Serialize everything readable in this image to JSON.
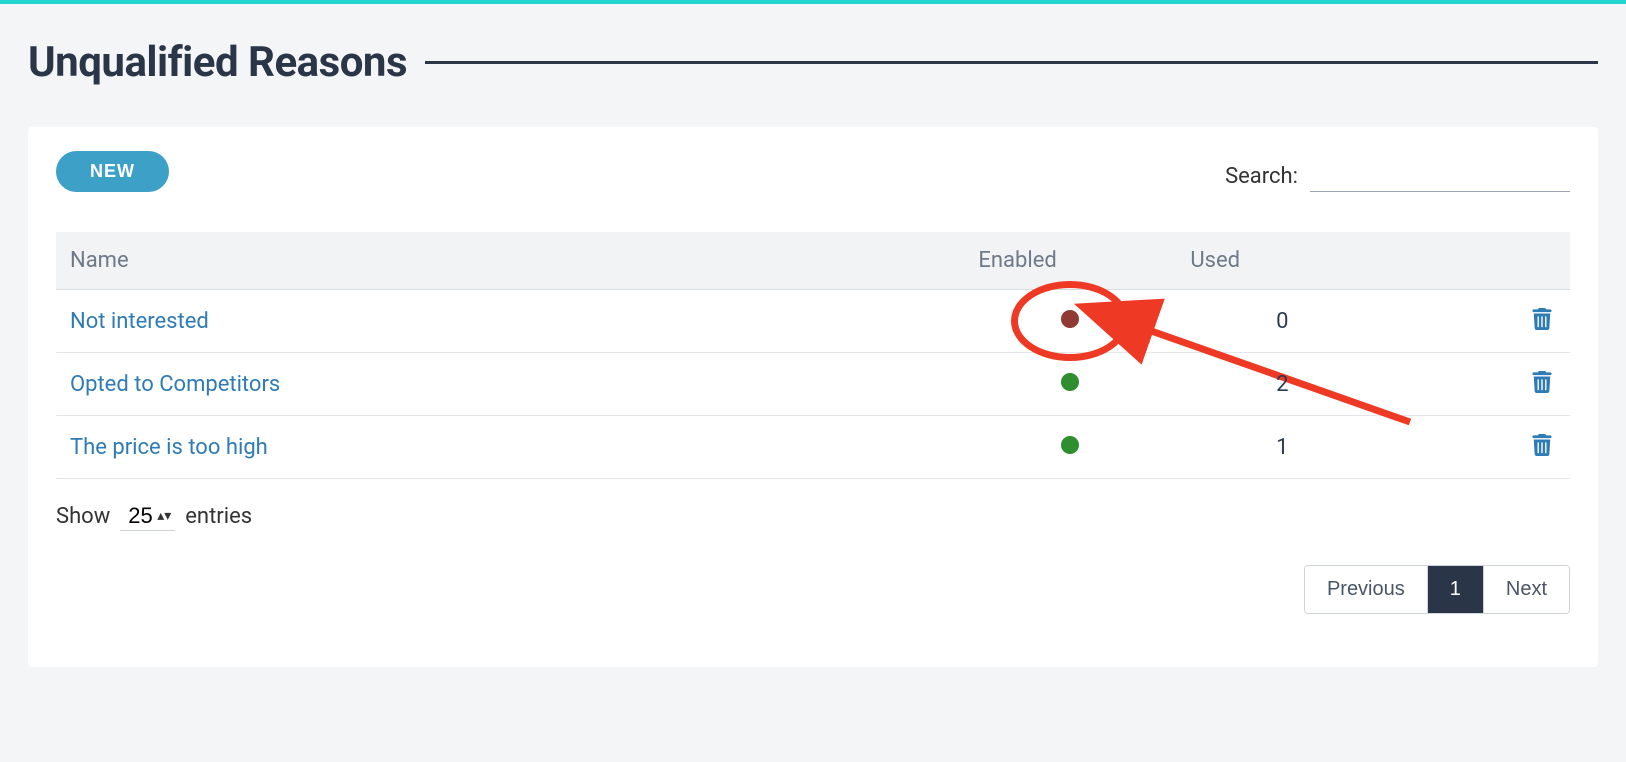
{
  "header": {
    "title": "Unqualified Reasons"
  },
  "toolbar": {
    "new_label": "NEW"
  },
  "search": {
    "label": "Search:",
    "value": ""
  },
  "table": {
    "columns": {
      "name": "Name",
      "enabled": "Enabled",
      "used": "Used"
    },
    "rows": [
      {
        "name": "Not interested",
        "enabled": false,
        "used": "0",
        "highlighted": true
      },
      {
        "name": "Opted to Competitors",
        "enabled": true,
        "used": "2",
        "highlighted": false
      },
      {
        "name": "The price is too high",
        "enabled": true,
        "used": "1",
        "highlighted": false
      }
    ]
  },
  "length": {
    "prefix": "Show",
    "value": "25",
    "suffix": "entries"
  },
  "pager": {
    "prev": "Previous",
    "pages": [
      "1"
    ],
    "current": "1",
    "next": "Next"
  }
}
